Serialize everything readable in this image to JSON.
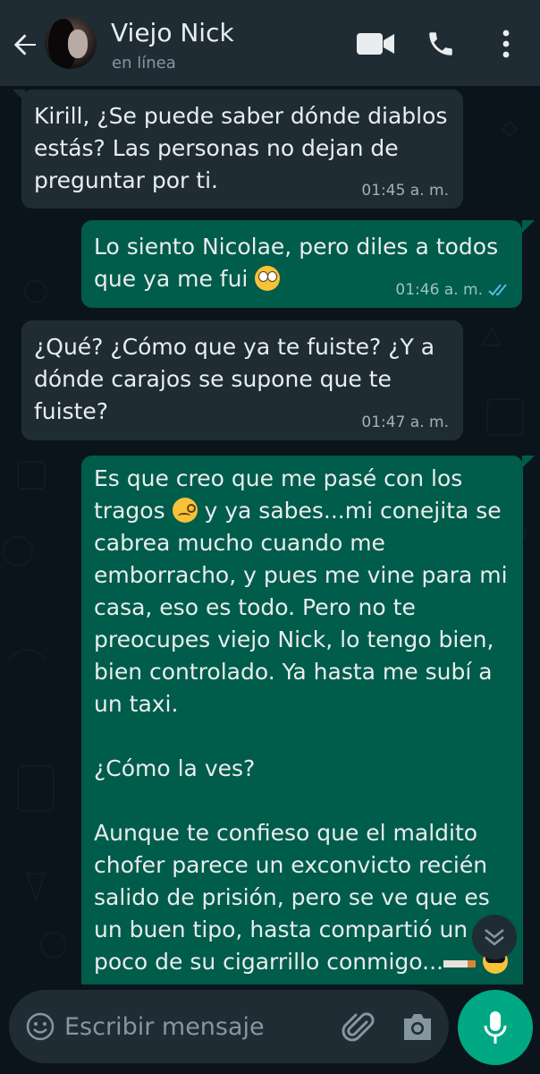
{
  "header": {
    "contact_name": "Viejo Nick",
    "status": "en línea",
    "icons": [
      "back-arrow-icon",
      "video-call-icon",
      "voice-call-icon",
      "more-options-icon"
    ]
  },
  "messages": [
    {
      "direction": "incoming",
      "text": "Kirill, ¿Se puede saber dónde diablos estás? Las personas no dejan de preguntar por ti.",
      "time": "01:45 a. m."
    },
    {
      "direction": "outgoing",
      "text_before_emoji": "Lo siento Nicolae, pero diles a todos que ya me fui ",
      "emoji": "face-with-rolling-eyes",
      "time": "01:46 a. m.",
      "status": "read"
    },
    {
      "direction": "incoming",
      "text": "¿Qué? ¿Cómo que ya te fuiste? ¿Y a dónde carajos se supone que te fuiste?",
      "time": "01:47 a. m."
    },
    {
      "direction": "outgoing",
      "p1_start": "Es que creo que me pasé con los tragos ",
      "p1_rest": " y ya sabes...mi conejita se cabrea mucho cuando me emborracho, y pues me vine para mi casa, eso es todo. Pero no te preocupes viejo Nick, lo tengo bien, bien controlado. Ya hasta me subí a un taxi.",
      "p2": "¿Cómo la ves?",
      "p3": "Aunque te confieso que el maldito chofer parece un exconvicto recién salido de prisión, pero se ve que es un buen tipo, hasta compartió un poco de su cigarrillo conmigo...",
      "emojis": [
        "woozy-face",
        "cigarette",
        "smiling-face-with-sunglasses"
      ]
    }
  ],
  "composer": {
    "placeholder": "Escribir mensaje",
    "icons": [
      "emoji-icon",
      "attach-icon",
      "camera-icon",
      "mic-icon"
    ]
  },
  "colors": {
    "header_bg": "#1f2c34",
    "chat_bg": "#0b141a",
    "incoming_bubble": "#1f2c34",
    "outgoing_bubble": "#005c4b",
    "accent": "#00a884",
    "read_ticks": "#53bdeb"
  }
}
